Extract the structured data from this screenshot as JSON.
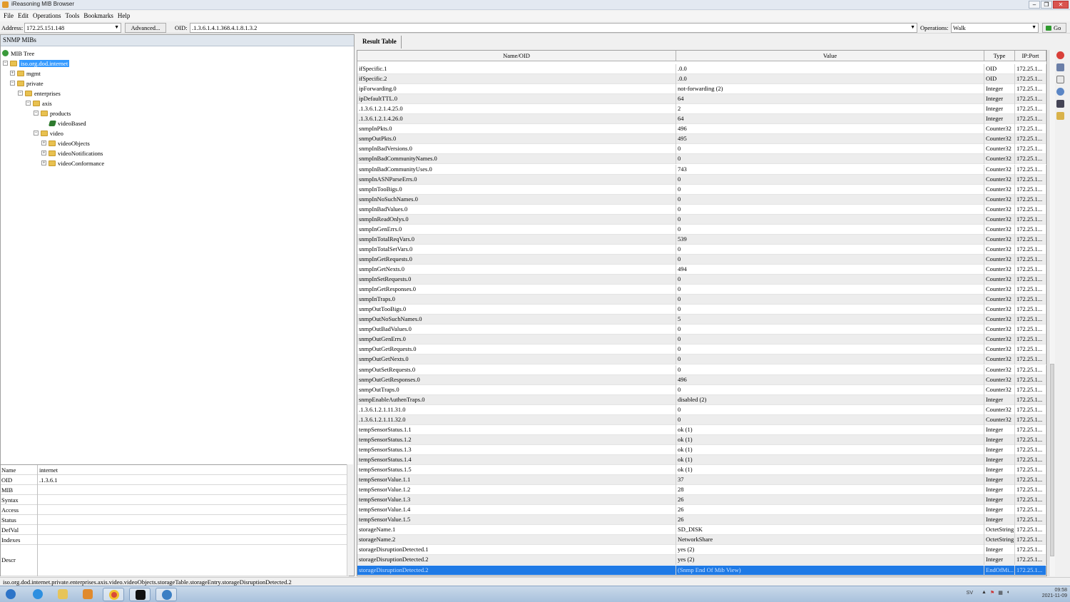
{
  "window": {
    "title": "iReasoning MIB Browser",
    "controls": [
      "–",
      "❐",
      "✕"
    ]
  },
  "menu": [
    "File",
    "Edit",
    "Operations",
    "Tools",
    "Bookmarks",
    "Help"
  ],
  "toolbar": {
    "address_label": "Address:",
    "address_value": "172.25.151.148",
    "advanced_label": "Advanced...",
    "oid_label": "OID:",
    "oid_value": ".1.3.6.1.4.1.368.4.1.8.1.3.2",
    "operations_label": "Operations:",
    "operation_value": "Walk",
    "go_label": "Go"
  },
  "left": {
    "header": "SNMP MIBs",
    "tree": {
      "root": "MIB Tree",
      "selected": "iso.org.dod.internet",
      "mgmt": "mgmt",
      "private": "private",
      "enterprises": "enterprises",
      "axis": "axis",
      "products": "products",
      "videoBased": "videoBased",
      "video": "video",
      "videoObjects": "videoObjects",
      "videoNotifications": "videoNotifications",
      "videoConformance": "videoConformance"
    },
    "props": [
      {
        "k": "Name",
        "v": "internet"
      },
      {
        "k": "OID",
        "v": ".1.3.6.1"
      },
      {
        "k": "MIB",
        "v": ""
      },
      {
        "k": "Syntax",
        "v": ""
      },
      {
        "k": "Access",
        "v": ""
      },
      {
        "k": "Status",
        "v": ""
      },
      {
        "k": "DefVal",
        "v": ""
      },
      {
        "k": "Indexes",
        "v": ""
      },
      {
        "k": "Descr",
        "v": ""
      }
    ]
  },
  "result": {
    "tab": "Result Table",
    "columns": [
      "Name/OID",
      "Value",
      "Type",
      "IP:Port"
    ],
    "rows": [
      [
        "ifSpecific.1",
        ".0.0",
        "OID",
        "172.25.1..."
      ],
      [
        "ifSpecific.2",
        ".0.0",
        "OID",
        "172.25.1..."
      ],
      [
        "ipForwarding.0",
        "not-forwarding (2)",
        "Integer",
        "172.25.1..."
      ],
      [
        "ipDefaultTTL.0",
        "64",
        "Integer",
        "172.25.1..."
      ],
      [
        ".1.3.6.1.2.1.4.25.0",
        "2",
        "Integer",
        "172.25.1..."
      ],
      [
        ".1.3.6.1.2.1.4.26.0",
        "64",
        "Integer",
        "172.25.1..."
      ],
      [
        "snmpInPkts.0",
        "496",
        "Counter32",
        "172.25.1..."
      ],
      [
        "snmpOutPkts.0",
        "495",
        "Counter32",
        "172.25.1..."
      ],
      [
        "snmpInBadVersions.0",
        "0",
        "Counter32",
        "172.25.1..."
      ],
      [
        "snmpInBadCommunityNames.0",
        "0",
        "Counter32",
        "172.25.1..."
      ],
      [
        "snmpInBadCommunityUses.0",
        "743",
        "Counter32",
        "172.25.1..."
      ],
      [
        "snmpInASNParseErrs.0",
        "0",
        "Counter32",
        "172.25.1..."
      ],
      [
        "snmpInTooBigs.0",
        "0",
        "Counter32",
        "172.25.1..."
      ],
      [
        "snmpInNoSuchNames.0",
        "0",
        "Counter32",
        "172.25.1..."
      ],
      [
        "snmpInBadValues.0",
        "0",
        "Counter32",
        "172.25.1..."
      ],
      [
        "snmpInReadOnlys.0",
        "0",
        "Counter32",
        "172.25.1..."
      ],
      [
        "snmpInGenErrs.0",
        "0",
        "Counter32",
        "172.25.1..."
      ],
      [
        "snmpInTotalReqVars.0",
        "539",
        "Counter32",
        "172.25.1..."
      ],
      [
        "snmpInTotalSetVars.0",
        "0",
        "Counter32",
        "172.25.1..."
      ],
      [
        "snmpInGetRequests.0",
        "0",
        "Counter32",
        "172.25.1..."
      ],
      [
        "snmpInGetNexts.0",
        "494",
        "Counter32",
        "172.25.1..."
      ],
      [
        "snmpInSetRequests.0",
        "0",
        "Counter32",
        "172.25.1..."
      ],
      [
        "snmpInGetResponses.0",
        "0",
        "Counter32",
        "172.25.1..."
      ],
      [
        "snmpInTraps.0",
        "0",
        "Counter32",
        "172.25.1..."
      ],
      [
        "snmpOutTooBigs.0",
        "0",
        "Counter32",
        "172.25.1..."
      ],
      [
        "snmpOutNoSuchNames.0",
        "5",
        "Counter32",
        "172.25.1..."
      ],
      [
        "snmpOutBadValues.0",
        "0",
        "Counter32",
        "172.25.1..."
      ],
      [
        "snmpOutGenErrs.0",
        "0",
        "Counter32",
        "172.25.1..."
      ],
      [
        "snmpOutGetRequests.0",
        "0",
        "Counter32",
        "172.25.1..."
      ],
      [
        "snmpOutGetNexts.0",
        "0",
        "Counter32",
        "172.25.1..."
      ],
      [
        "snmpOutSetRequests.0",
        "0",
        "Counter32",
        "172.25.1..."
      ],
      [
        "snmpOutGetResponses.0",
        "496",
        "Counter32",
        "172.25.1..."
      ],
      [
        "snmpOutTraps.0",
        "0",
        "Counter32",
        "172.25.1..."
      ],
      [
        "snmpEnableAuthenTraps.0",
        "disabled (2)",
        "Integer",
        "172.25.1..."
      ],
      [
        ".1.3.6.1.2.1.11.31.0",
        "0",
        "Counter32",
        "172.25.1..."
      ],
      [
        ".1.3.6.1.2.1.11.32.0",
        "0",
        "Counter32",
        "172.25.1..."
      ],
      [
        "tempSensorStatus.1.1",
        "ok (1)",
        "Integer",
        "172.25.1..."
      ],
      [
        "tempSensorStatus.1.2",
        "ok (1)",
        "Integer",
        "172.25.1..."
      ],
      [
        "tempSensorStatus.1.3",
        "ok (1)",
        "Integer",
        "172.25.1..."
      ],
      [
        "tempSensorStatus.1.4",
        "ok (1)",
        "Integer",
        "172.25.1..."
      ],
      [
        "tempSensorStatus.1.5",
        "ok (1)",
        "Integer",
        "172.25.1..."
      ],
      [
        "tempSensorValue.1.1",
        "37",
        "Integer",
        "172.25.1..."
      ],
      [
        "tempSensorValue.1.2",
        "28",
        "Integer",
        "172.25.1..."
      ],
      [
        "tempSensorValue.1.3",
        "26",
        "Integer",
        "172.25.1..."
      ],
      [
        "tempSensorValue.1.4",
        "26",
        "Integer",
        "172.25.1..."
      ],
      [
        "tempSensorValue.1.5",
        "26",
        "Integer",
        "172.25.1..."
      ],
      [
        "storageName.1",
        "SD_DISK",
        "OctetString",
        "172.25.1..."
      ],
      [
        "storageName.2",
        "NetworkShare",
        "OctetString",
        "172.25.1..."
      ],
      [
        "storageDisruptionDetected.1",
        "yes (2)",
        "Integer",
        "172.25.1..."
      ],
      [
        "storageDisruptionDetected.2",
        "yes (2)",
        "Integer",
        "172.25.1..."
      ],
      [
        "storageDisruptionDetected.2",
        "(Snmp End Of Mib View)",
        "EndOfMi...",
        "172.25.1..."
      ]
    ],
    "selected_row": 50
  },
  "status": "iso.org.dod.internet.private.enterprises.axis.video.videoObjects.storageTable.storageEntry.storageDisruptionDetected.2",
  "tray": {
    "lang": "SV",
    "time": "09:58",
    "date": "2021-11-09"
  }
}
